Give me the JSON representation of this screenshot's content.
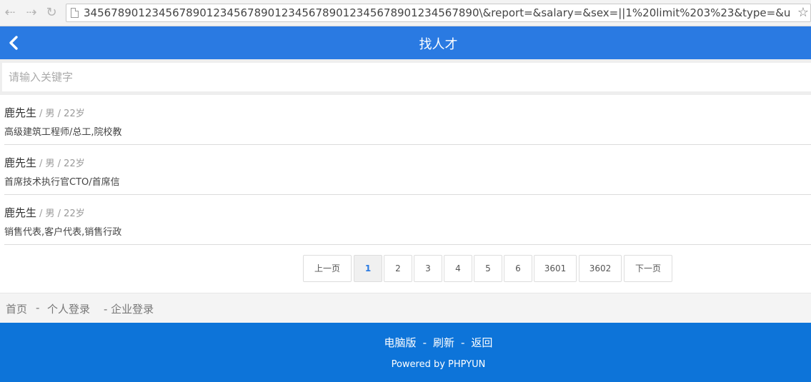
{
  "browser": {
    "url": "3456789012345678901234567890123456789012345678901234567890\\&report=&salary=&sex=||1%20limit%203%23&type=&uptime="
  },
  "header": {
    "title": "找人才"
  },
  "search": {
    "placeholder": "请输入关键字"
  },
  "resumes": [
    {
      "name": "鹿先生",
      "meta": "/ 男 / 22岁",
      "job": "高级建筑工程师/总工,院校教"
    },
    {
      "name": "鹿先生",
      "meta": "/ 男 / 22岁",
      "job": "首席技术执行官CTO/首席信"
    },
    {
      "name": "鹿先生",
      "meta": "/ 男 / 22岁",
      "job": "销售代表,客户代表,销售行政"
    }
  ],
  "pagination": {
    "prev": "上一页",
    "pages": [
      "1",
      "2",
      "3",
      "4",
      "5",
      "6",
      "3601",
      "3602"
    ],
    "current": "1",
    "next": "下一页"
  },
  "footer_links": {
    "home": "首页",
    "sep1": "-",
    "personal_login": "个人登录",
    "company_login": "- 企业登录"
  },
  "site_footer": {
    "pc_version": "电脑版",
    "sep": "-",
    "refresh": "刷新",
    "back": "返回",
    "powered": "Powered by PHPYUN"
  },
  "colors": {
    "header_blue": "#2a7ae2",
    "footer_blue": "#0d74d9"
  }
}
